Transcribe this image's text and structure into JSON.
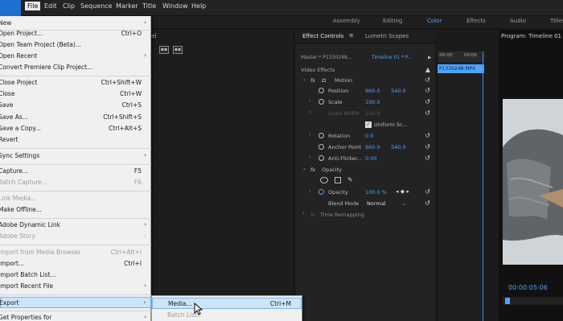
{
  "menubar": {
    "items": [
      {
        "label": "File"
      },
      {
        "label": "Edit"
      },
      {
        "label": "Clip"
      },
      {
        "label": "Sequence"
      },
      {
        "label": "Marker"
      },
      {
        "label": "Title"
      },
      {
        "label": "Window"
      },
      {
        "label": "Help"
      }
    ]
  },
  "workspaces": {
    "items": [
      {
        "label": "Assembly"
      },
      {
        "label": "Editing"
      },
      {
        "label": "Color"
      },
      {
        "label": "Effects"
      },
      {
        "label": "Audio"
      },
      {
        "label": "Titles"
      }
    ],
    "active": "Color",
    "accent": "#4fa3ff"
  },
  "left_panel": {
    "title_fragment": "el"
  },
  "effect_controls": {
    "tab_active": "Effect Controls",
    "tab_other": "Lumetri Scopes",
    "master": "Master * P1330248...",
    "timeline": "Timeline 01 * P...",
    "mini_ruler_left": ":00:00",
    "mini_ruler_right": "00:00",
    "clip_name": "P1330248.MP4",
    "video_effects": "Video Effects",
    "motion": "Motion",
    "position": {
      "label": "Position",
      "x": "960.0",
      "y": "540.0"
    },
    "scale": {
      "label": "Scale",
      "value": "100.0"
    },
    "scale_width": {
      "label": "Scale Width",
      "value": "100.0"
    },
    "uniform_scale": "Uniform Sc...",
    "rotation": {
      "label": "Rotation",
      "value": "0.0"
    },
    "anchor_point": {
      "label": "Anchor Point",
      "x": "960.0",
      "y": "540.0"
    },
    "anti_flicker": {
      "label": "Anti-Flicker...",
      "value": "0.00"
    },
    "opacity_section": "Opacity",
    "opacity": {
      "label": "Opacity",
      "value": "100.0 %"
    },
    "blend_mode": {
      "label": "Blend Mode",
      "value": "Normal"
    },
    "time_remapping": "Time Remapping"
  },
  "program_monitor": {
    "title": "Program: Timeline 01",
    "timecode": "00:00:05:06"
  },
  "file_menu": {
    "items": [
      {
        "label": "New",
        "shortcut": "",
        "submenu": true,
        "disabled": false
      },
      {
        "label": "Open Project...",
        "shortcut": "Ctrl+O",
        "submenu": false,
        "disabled": false
      },
      {
        "label": "Open Team Project (Beta)...",
        "shortcut": "",
        "submenu": false,
        "disabled": false
      },
      {
        "label": "Open Recent",
        "shortcut": "",
        "submenu": true,
        "disabled": false
      },
      {
        "label": "Convert Premiere Clip Project...",
        "shortcut": "",
        "submenu": false,
        "disabled": false
      },
      {
        "label": "Close Project",
        "shortcut": "Ctrl+Shift+W",
        "submenu": false,
        "disabled": false
      },
      {
        "label": "Close",
        "shortcut": "Ctrl+W",
        "submenu": false,
        "disabled": false
      },
      {
        "label": "Save",
        "shortcut": "Ctrl+S",
        "submenu": false,
        "disabled": false
      },
      {
        "label": "Save As...",
        "shortcut": "Ctrl+Shift+S",
        "submenu": false,
        "disabled": false
      },
      {
        "label": "Save a Copy...",
        "shortcut": "Ctrl+Alt+S",
        "submenu": false,
        "disabled": false
      },
      {
        "label": "Revert",
        "shortcut": "",
        "submenu": false,
        "disabled": false
      },
      {
        "label": "Sync Settings",
        "shortcut": "",
        "submenu": true,
        "disabled": false
      },
      {
        "label": "Capture...",
        "shortcut": "F5",
        "submenu": false,
        "disabled": false
      },
      {
        "label": "Batch Capture...",
        "shortcut": "F6",
        "submenu": false,
        "disabled": true
      },
      {
        "label": "Link Media...",
        "shortcut": "",
        "submenu": false,
        "disabled": true
      },
      {
        "label": "Make Offline...",
        "shortcut": "",
        "submenu": false,
        "disabled": false
      },
      {
        "label": "Adobe Dynamic Link",
        "shortcut": "",
        "submenu": true,
        "disabled": false
      },
      {
        "label": "Adobe Story",
        "shortcut": "",
        "submenu": true,
        "disabled": true
      },
      {
        "label": "Import from Media Browser",
        "shortcut": "Ctrl+Alt+I",
        "submenu": false,
        "disabled": true
      },
      {
        "label": "Import...",
        "shortcut": "Ctrl+I",
        "submenu": false,
        "disabled": false
      },
      {
        "label": "Import Batch List...",
        "shortcut": "",
        "submenu": false,
        "disabled": false
      },
      {
        "label": "Import Recent File",
        "shortcut": "",
        "submenu": true,
        "disabled": false
      },
      {
        "label": "Export",
        "shortcut": "",
        "submenu": true,
        "disabled": false
      },
      {
        "label": "Get Properties for",
        "shortcut": "",
        "submenu": true,
        "disabled": false
      }
    ]
  },
  "export_submenu": {
    "items": [
      {
        "label": "Media...",
        "shortcut": "Ctrl+M",
        "disabled": false
      },
      {
        "label": "Batch List...",
        "shortcut": "",
        "disabled": true
      }
    ]
  },
  "colors": {
    "accent": "#4fa3ff",
    "menu_bg": "#f0f0f0",
    "menu_highlight": "#cce4f7"
  }
}
